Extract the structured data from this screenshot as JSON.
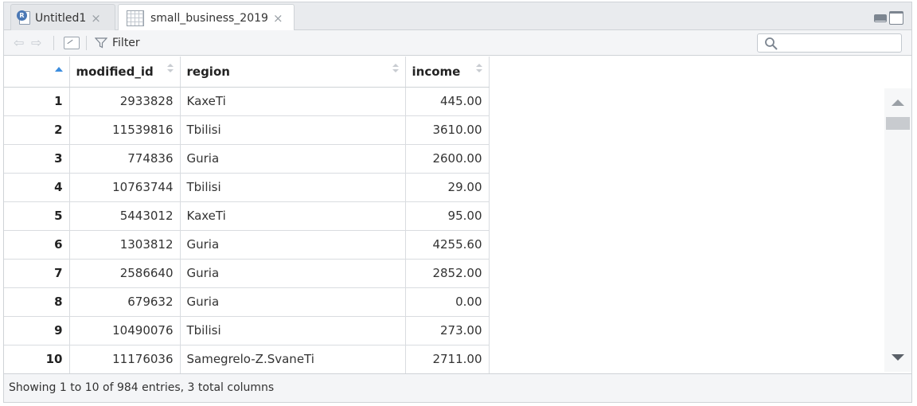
{
  "tabs": [
    {
      "label": "Untitled1",
      "icon": "r-document-icon",
      "active": false
    },
    {
      "label": "small_business_2019",
      "icon": "data-grid-icon",
      "active": true
    }
  ],
  "toolbar": {
    "filter_label": "Filter",
    "search_placeholder": ""
  },
  "table": {
    "columns": [
      "modified_id",
      "region",
      "income"
    ],
    "sorted_column": "rownum",
    "rows": [
      {
        "n": "1",
        "modified_id": "2933828",
        "region": "KaxeTi",
        "income": "445.00"
      },
      {
        "n": "2",
        "modified_id": "11539816",
        "region": "Tbilisi",
        "income": "3610.00"
      },
      {
        "n": "3",
        "modified_id": "774836",
        "region": "Guria",
        "income": "2600.00"
      },
      {
        "n": "4",
        "modified_id": "10763744",
        "region": "Tbilisi",
        "income": "29.00"
      },
      {
        "n": "5",
        "modified_id": "5443012",
        "region": "KaxeTi",
        "income": "95.00"
      },
      {
        "n": "6",
        "modified_id": "1303812",
        "region": "Guria",
        "income": "4255.60"
      },
      {
        "n": "7",
        "modified_id": "2586640",
        "region": "Guria",
        "income": "2852.00"
      },
      {
        "n": "8",
        "modified_id": "679632",
        "region": "Guria",
        "income": "0.00"
      },
      {
        "n": "9",
        "modified_id": "10490076",
        "region": "Tbilisi",
        "income": "273.00"
      },
      {
        "n": "10",
        "modified_id": "11176036",
        "region": "Samegrelo-Z.SvaneTi",
        "income": "2711.00"
      }
    ]
  },
  "footer": {
    "status": "Showing 1 to 10 of 984 entries, 3 total columns"
  },
  "colors": {
    "sort_accent": "#3c8dde",
    "border": "#cfd3d7",
    "tab_bar": "#e9ebee"
  }
}
